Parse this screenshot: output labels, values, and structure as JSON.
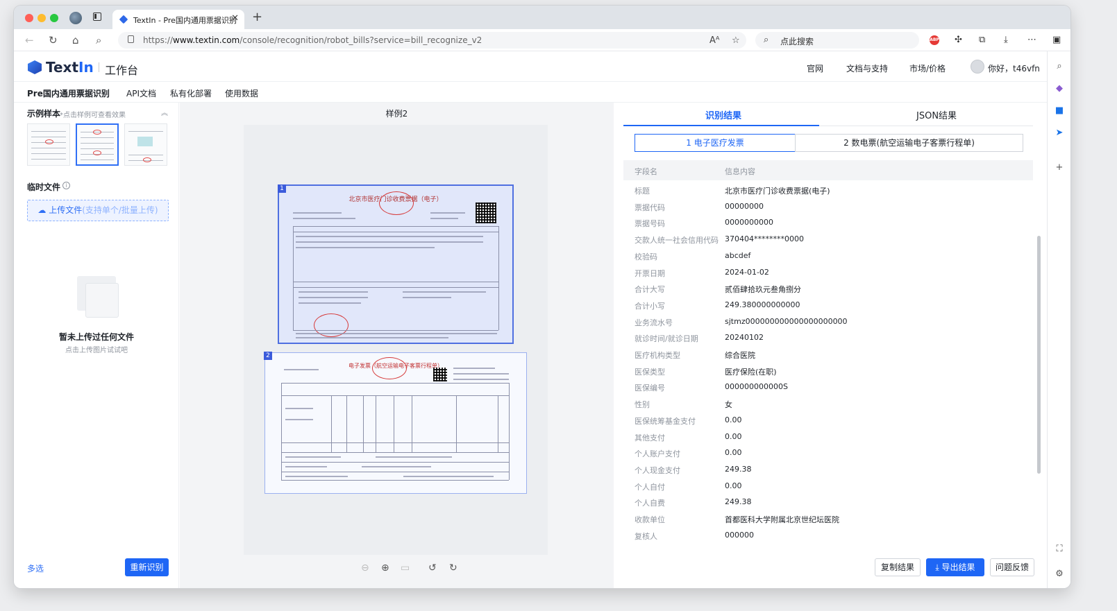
{
  "browser": {
    "tab_title": "TextIn - Pre国内通用票据识别",
    "url_prefix": "https://",
    "url_host": "www.textin.com",
    "url_path": "/console/recognition/robot_bills?service=bill_recognize_v2",
    "search_placeholder": "点此搜索",
    "abp_label": "ABP"
  },
  "header": {
    "logo_text": "Text",
    "logo_accent": "In",
    "workspace": "工作台",
    "nav": [
      "官网",
      "文档与支持",
      "市场/价格"
    ],
    "user": "你好，t46vfn"
  },
  "subnav": [
    "Pre国内通用票据识别",
    "API文档",
    "私有化部署",
    "使用数据"
  ],
  "left": {
    "samples_title": "示例样本",
    "samples_hint": "*点击样例可查看效果",
    "temp_title": "临时文件",
    "upload_label": "上传文件",
    "upload_sub": "(支持单个/批量上传)",
    "empty_title": "暂未上传过任何文件",
    "empty_sub": "点击上传图片试试吧",
    "multi_select": "多选",
    "rerun_button": "重新识别"
  },
  "center": {
    "title": "样例2",
    "doc1_index": "1",
    "doc1_title": "北京市医疗门诊收费票据（电子）",
    "doc2_index": "2",
    "doc2_title": "电子发票（航空运输电子客票行程单）"
  },
  "right": {
    "tabs": [
      "识别结果",
      "JSON结果"
    ],
    "segments": [
      "1 电子医疗发票",
      "2 数电票(航空运输电子客票行程单)"
    ],
    "col_field": "字段名",
    "col_value": "信息内容",
    "fields": [
      {
        "k": "标题",
        "v": "北京市医疗门诊收费票据(电子)"
      },
      {
        "k": "票据代码",
        "v": "00000000"
      },
      {
        "k": "票据号码",
        "v": "0000000000"
      },
      {
        "k": "交款人统一社会信用代码",
        "v": "370404********0000"
      },
      {
        "k": "校验码",
        "v": "abcdef"
      },
      {
        "k": "开票日期",
        "v": "2024-01-02"
      },
      {
        "k": "合计大写",
        "v": "贰佰肆拾玖元叁角捌分"
      },
      {
        "k": "合计小写",
        "v": "249.380000000000"
      },
      {
        "k": "业务流水号",
        "v": "sjtmz000000000000000000000"
      },
      {
        "k": "就诊时间/就诊日期",
        "v": "20240102"
      },
      {
        "k": "医疗机构类型",
        "v": "综合医院"
      },
      {
        "k": "医保类型",
        "v": "医疗保险(在职)"
      },
      {
        "k": "医保编号",
        "v": "000000000000S"
      },
      {
        "k": "性别",
        "v": "女"
      },
      {
        "k": "医保统筹基金支付",
        "v": "0.00"
      },
      {
        "k": "其他支付",
        "v": "0.00"
      },
      {
        "k": "个人账户支付",
        "v": "0.00"
      },
      {
        "k": "个人现金支付",
        "v": "249.38"
      },
      {
        "k": "个人自付",
        "v": "0.00"
      },
      {
        "k": "个人自费",
        "v": "249.38"
      },
      {
        "k": "收款单位",
        "v": "首都医科大学附属北京世纪坛医院"
      },
      {
        "k": "复核人",
        "v": "000000"
      }
    ],
    "copy_button": "复制结果",
    "export_button": "导出结果",
    "feedback_button": "问题反馈"
  },
  "colors": {
    "accent": "#1e66f5",
    "stamp": "#d63a3a"
  }
}
